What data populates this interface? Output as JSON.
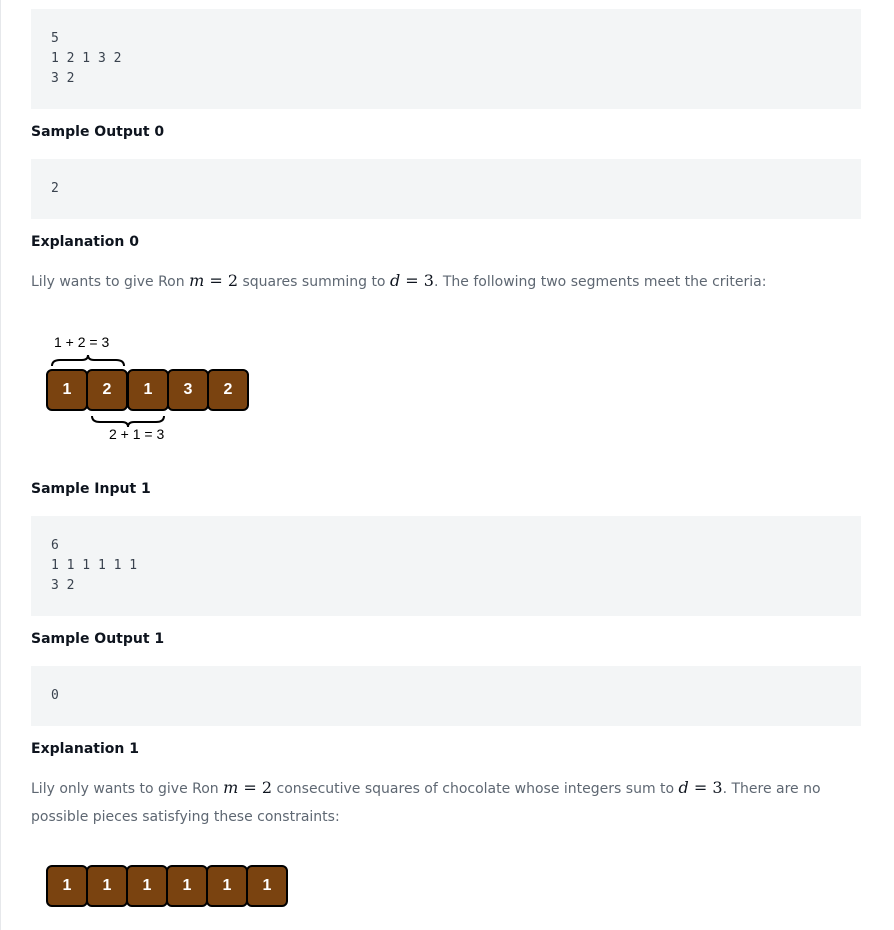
{
  "sample_input_0": {
    "lines": [
      "5",
      "1 2 1 3 2",
      "3 2"
    ]
  },
  "sample_output_0": {
    "heading": "Sample Output 0",
    "lines": [
      "2"
    ]
  },
  "explanation_0": {
    "heading": "Explanation 0",
    "text_before_m": "Lily wants to give Ron ",
    "m_var": "m",
    "m_value": " = 2",
    "text_mid": " squares summing to ",
    "d_var": "d",
    "d_value": " = 3",
    "text_after": ". The following two segments meet the criteria:",
    "diagram": {
      "squares": [
        "1",
        "2",
        "1",
        "3",
        "2"
      ],
      "top_label": "1 + 2 = 3",
      "bottom_label": "2 + 1 = 3",
      "square_color": "#7a4310"
    }
  },
  "sample_input_1": {
    "heading": "Sample Input 1",
    "lines": [
      "6",
      "1 1 1 1 1 1",
      "3 2"
    ]
  },
  "sample_output_1": {
    "heading": "Sample Output 1",
    "lines": [
      "0"
    ]
  },
  "explanation_1": {
    "heading": "Explanation 1",
    "text_before_m": "Lily only wants to give Ron ",
    "m_var": "m",
    "m_value": " = 2",
    "text_mid": " consecutive squares of chocolate whose integers sum to ",
    "d_var": "d",
    "d_value": " = 3",
    "text_after": ". There are no possible pieces satisfying these constraints:",
    "diagram": {
      "squares": [
        "1",
        "1",
        "1",
        "1",
        "1",
        "1"
      ]
    }
  }
}
